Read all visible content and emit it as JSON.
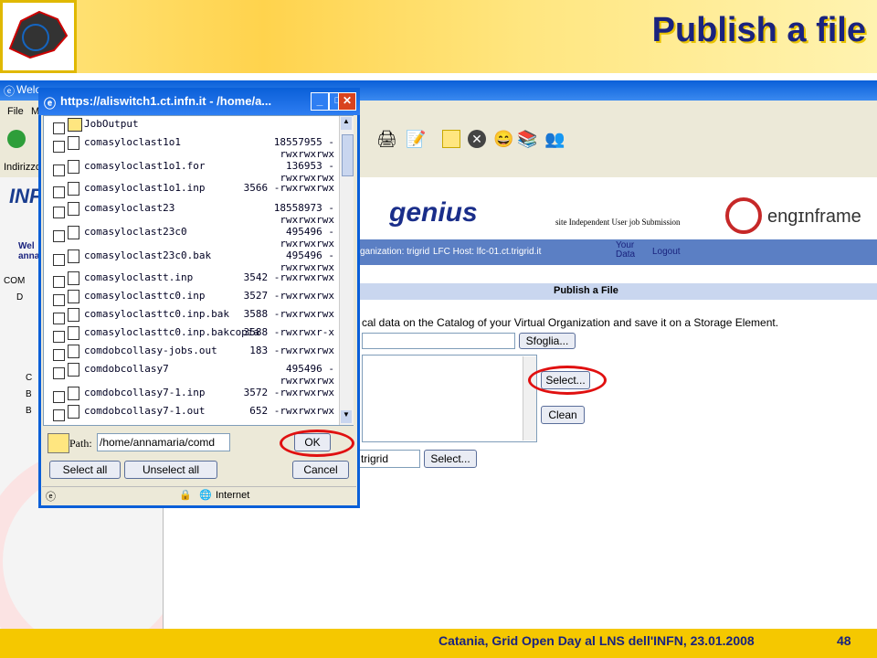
{
  "slide": {
    "title": "Publish a file",
    "footer": "Catania, Grid Open Day al LNS dell'INFN, 23.01.2008",
    "page_number": "48"
  },
  "browser": {
    "title": "Welc",
    "menu": [
      "File",
      "M"
    ],
    "address_label": "Indirizzo"
  },
  "site": {
    "genius_logo": "genius",
    "tagline": "site Independent User job Submission",
    "enginframe_logo": "engɪnframe",
    "infn_text": "INF",
    "welcome_text": "Wel\nanna",
    "org_text": "ganization: trigrid",
    "lfc_text": "LFC Host: lfc-01.ct.trigrid.it",
    "your_data": "Your\nData",
    "logout": "Logout",
    "page_heading": "Publish a File",
    "instructions": "cal data on the Catalog of your Virtual Organization and save it on a Storage Element.",
    "browse_button": "Sfoglia...",
    "select_button": "Select...",
    "clean_button": "Clean",
    "vo_value": "trigrid",
    "select_button_2": "Select...",
    "tree_items": [
      "COM",
      "D",
      "C",
      "B",
      "B"
    ]
  },
  "popup": {
    "title": "https://aliswitch1.ct.infn.it - /home/a...",
    "files": [
      {
        "name": "JobOutput",
        "size": "",
        "folder": true
      },
      {
        "name": "comasyloclast1o1",
        "size": "18557955 -\nrwxrwxrwx"
      },
      {
        "name": "comasyloclast1o1.for",
        "size": "136953 -\nrwxrwxrwx"
      },
      {
        "name": "comasyloclast1o1.inp",
        "size": "3566 -rwxrwxrwx"
      },
      {
        "name": "comasyloclast23",
        "size": "18558973 -\nrwxrwxrwx"
      },
      {
        "name": "comasyloclast23c0",
        "size": "495496 -\nrwxrwxrwx"
      },
      {
        "name": "comasyloclast23c0.bak",
        "size": "495496 -\nrwxrwxrwx"
      },
      {
        "name": "comasyloclastt.inp",
        "size": "3542 -rwxrwxrwx"
      },
      {
        "name": "comasyloclasttc0.inp",
        "size": "3527 -rwxrwxrwx"
      },
      {
        "name": "comasyloclasttc0.inp.bak",
        "size": "3588 -rwxrwxrwx"
      },
      {
        "name": "comasyloclasttc0.inp.bakcopia",
        "size": "3588 -rwxrwxr-x"
      },
      {
        "name": "comdobcollasy-jobs.out",
        "size": "183 -rwxrwxrwx"
      },
      {
        "name": "comdobcollasy7",
        "size": "495496 -\nrwxrwxrwx"
      },
      {
        "name": "comdobcollasy7-1.inp",
        "size": "3572 -rwxrwxrwx"
      },
      {
        "name": "comdobcollasy7-1.out",
        "size": "652 -rwxrwxrwx"
      }
    ],
    "path_label": "Path:",
    "path_value": "/home/annamaria/comd",
    "ok_button": "OK",
    "select_all": "Select all",
    "unselect_all": "Unselect all",
    "cancel": "Cancel",
    "status_zone": "Internet"
  },
  "colors": {
    "accent": "#1a237e",
    "highlight": "#e01010",
    "footer": "#f5c800"
  }
}
